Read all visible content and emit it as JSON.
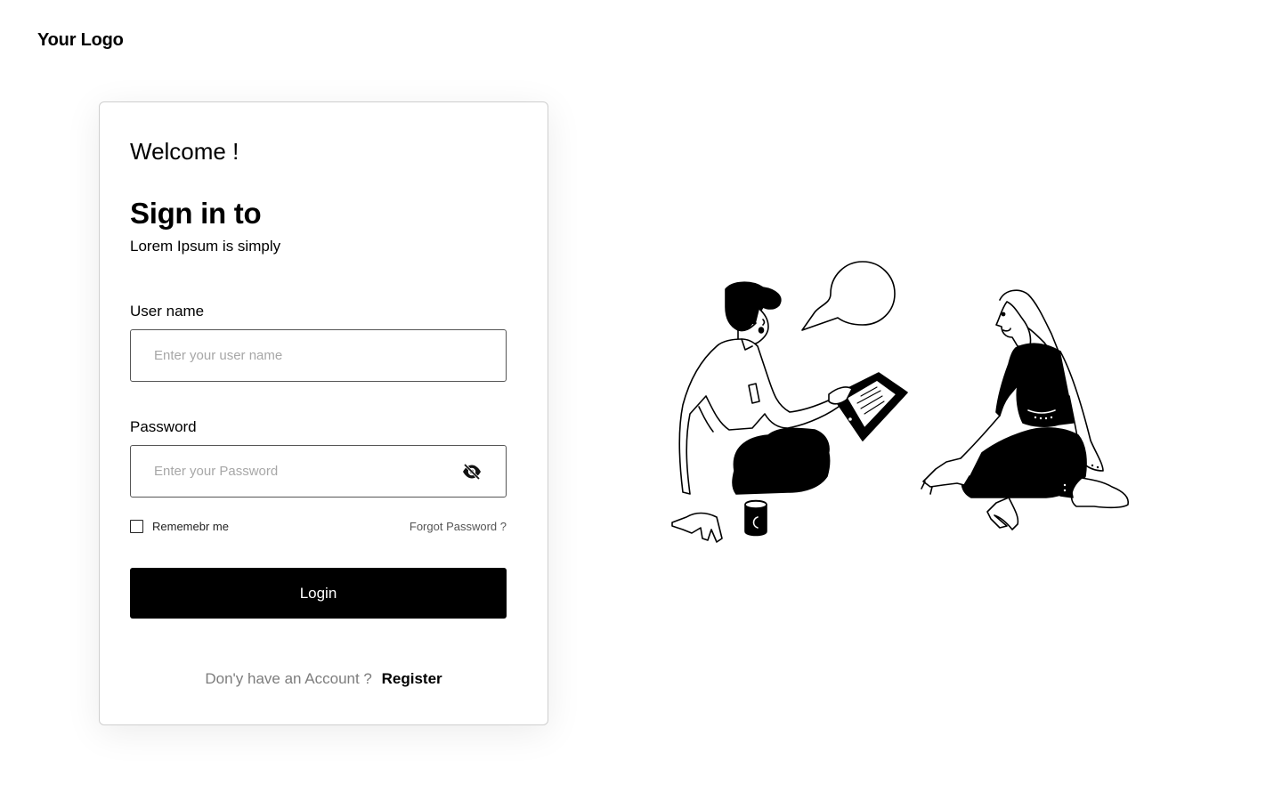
{
  "brand": {
    "logo_text": "Your Logo"
  },
  "form": {
    "welcome": "Welcome !",
    "title": "Sign in to",
    "subtitle": "Lorem Ipsum is simply",
    "username": {
      "label": "User name",
      "placeholder": "Enter your user name",
      "value": ""
    },
    "password": {
      "label": "Password",
      "placeholder": "Enter your Password",
      "value": "",
      "toggle_icon": "eye-slash-icon"
    },
    "remember": {
      "label": "Rememebr me",
      "checked": false
    },
    "forgot_label": "Forgot Password ?",
    "login_label": "Login",
    "footer": {
      "question": "Don'y have an Account ?",
      "register_label": "Register"
    }
  },
  "illustration": {
    "icon": "people-conversation-illustration"
  },
  "colors": {
    "background": "#ffffff",
    "primary": "#000000",
    "muted_text": "#7d7d7d",
    "placeholder": "#a7a7a7",
    "border": "#cfcfcf"
  }
}
